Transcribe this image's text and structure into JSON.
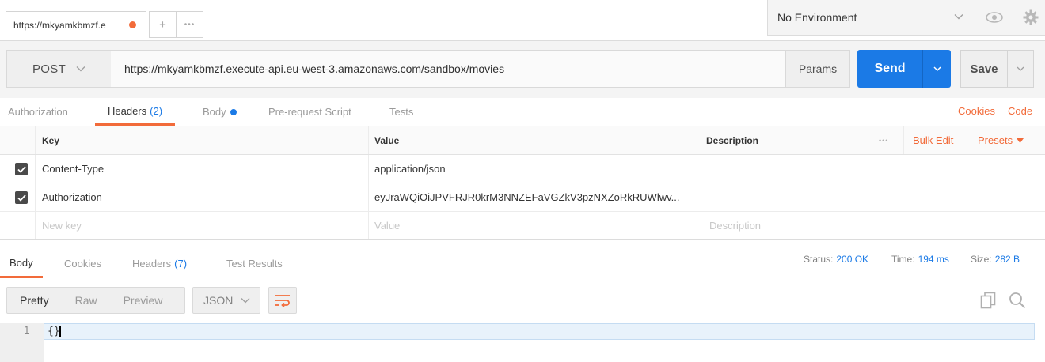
{
  "tab": {
    "title": "https://mkyamkbmzf.e",
    "status_color": "#f26b3a",
    "add_label": "+",
    "more_label": "•••"
  },
  "environment": {
    "selected": "No Environment"
  },
  "request": {
    "method": "POST",
    "url": "https://mkyamkbmzf.execute-api.eu-west-3.amazonaws.com/sandbox/movies",
    "params_label": "Params",
    "send_label": "Send",
    "save_label": "Save"
  },
  "request_tabs": {
    "authorization": "Authorization",
    "headers": "Headers",
    "headers_count": "(2)",
    "body": "Body",
    "prerequest": "Pre-request Script",
    "tests": "Tests",
    "cookies_link": "Cookies",
    "code_link": "Code"
  },
  "headers_table": {
    "columns": {
      "key": "Key",
      "value": "Value",
      "description": "Description"
    },
    "more_label": "•••",
    "bulk_edit": "Bulk Edit",
    "presets": "Presets",
    "rows": [
      {
        "key": "Content-Type",
        "value": "application/json",
        "checked": true
      },
      {
        "key": "Authorization",
        "value": "eyJraWQiOiJPVFRJR0krM3NNZEFaVGZkV3pzNXZoRkRUWlwv...",
        "checked": true
      }
    ],
    "placeholders": {
      "key": "New key",
      "value": "Value",
      "description": "Description"
    }
  },
  "response_tabs": {
    "body": "Body",
    "cookies": "Cookies",
    "headers": "Headers",
    "headers_count": "(7)",
    "test_results": "Test Results"
  },
  "response_status": {
    "status_label": "Status:",
    "status_value": "200 OK",
    "time_label": "Time:",
    "time_value": "194 ms",
    "size_label": "Size:",
    "size_value": "282 B"
  },
  "response_view": {
    "pretty": "Pretty",
    "raw": "Raw",
    "preview": "Preview",
    "format": "JSON"
  },
  "code": {
    "line_number": "1",
    "text": "{}"
  },
  "colors": {
    "accent": "#f26b3a",
    "primary": "#1b7ae6"
  }
}
